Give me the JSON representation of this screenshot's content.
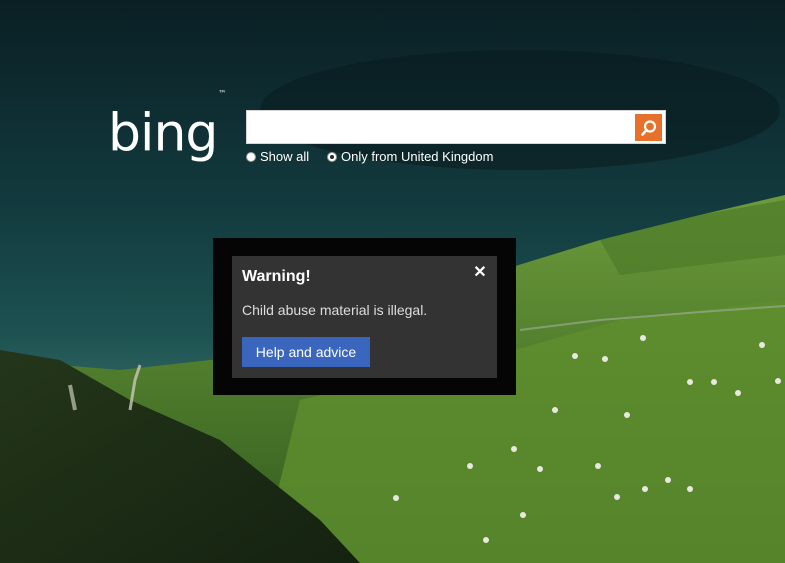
{
  "header": {
    "logo_text": "bing",
    "trademark": "™"
  },
  "search": {
    "value": "",
    "placeholder": "",
    "button_icon": "magnifier-icon"
  },
  "scope_options": {
    "show_all": "Show all",
    "only_uk": "Only from United Kingdom",
    "selected": "only_uk"
  },
  "warning_dialog": {
    "title": "Warning!",
    "close_glyph": "✕",
    "message": "Child abuse material is illegal.",
    "button_label": "Help and advice"
  },
  "colors": {
    "search_button": "#e5712b",
    "help_button": "#3a67bd",
    "dialog_bg": "#333333"
  }
}
